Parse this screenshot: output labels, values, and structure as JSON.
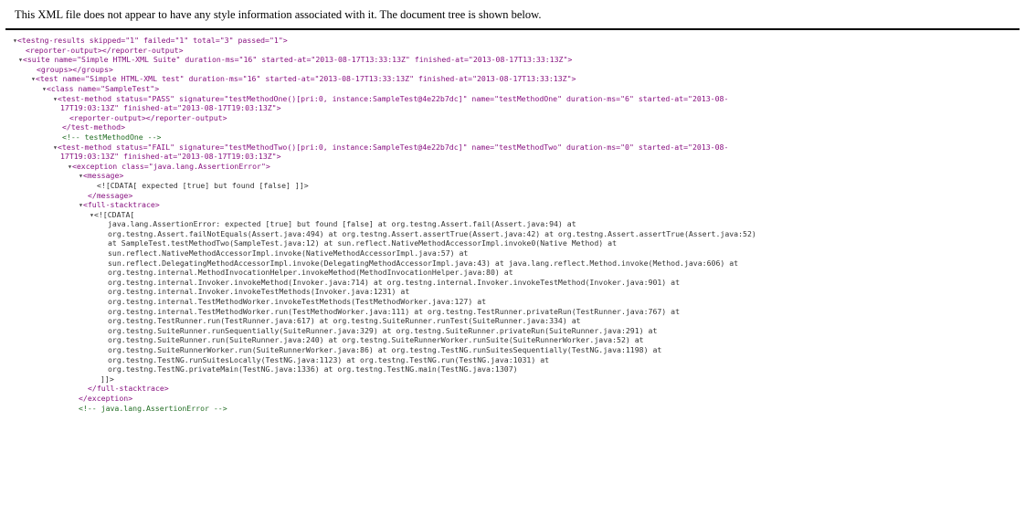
{
  "header": {
    "notice": "This XML file does not appear to have any style information associated with it. The document tree is shown below."
  },
  "colors": {
    "tag": "#881280",
    "attr_name": "#994500",
    "attr_value": "#1a1aa6",
    "comment": "#236e25",
    "text": "#333333"
  },
  "icons": {
    "fold": "expand-collapse-triangle"
  },
  "tree": {
    "results_open": "<testng-results skipped=\"1\" failed=\"1\" total=\"3\" passed=\"1\">",
    "reporter_output": "<reporter-output></reporter-output>",
    "suite_open": "<suite name=\"Simple HTML-XML Suite\" duration-ms=\"16\" started-at=\"2013-08-17T13:33:13Z\" finished-at=\"2013-08-17T13:33:13Z\">",
    "groups": "<groups></groups>",
    "test_open": "<test name=\"Simple HTML-XML test\" duration-ms=\"16\" started-at=\"2013-08-17T13:33:13Z\" finished-at=\"2013-08-17T13:33:13Z\">",
    "class_open": "<class name=\"SampleTest\">",
    "tm1_open_a": "<test-method status=\"PASS\" signature=\"testMethodOne()[pri:0, instance:SampleTest@4e22b7dc]\" name=\"testMethodOne\" duration-ms=\"6\" started-at=\"2013-08-",
    "tm1_open_b": "17T19:03:13Z\" finished-at=\"2013-08-17T19:03:13Z\">",
    "tm1_reporter_output": "<reporter-output></reporter-output>",
    "tm1_close": "</test-method>",
    "tm1_comment": "<!--  testMethodOne  -->",
    "tm2_open_a": "<test-method status=\"FAIL\" signature=\"testMethodTwo()[pri:0, instance:SampleTest@4e22b7dc]\" name=\"testMethodTwo\" duration-ms=\"0\" started-at=\"2013-08-",
    "tm2_open_b": "17T19:03:13Z\" finished-at=\"2013-08-17T19:03:13Z\">",
    "exception_open": "<exception class=\"java.lang.AssertionError\">",
    "message_open": "<message>",
    "message_cdata": "<![CDATA[ expected [true] but found [false] ]]>",
    "message_close": "</message>",
    "stack_open": "<full-stacktrace>",
    "cdata_open": "<![CDATA[",
    "stacktrace": "java.lang.AssertionError: expected [true] but found [false] at org.testng.Assert.fail(Assert.java:94) at\norg.testng.Assert.failNotEquals(Assert.java:494) at org.testng.Assert.assertTrue(Assert.java:42) at org.testng.Assert.assertTrue(Assert.java:52)\nat SampleTest.testMethodTwo(SampleTest.java:12) at sun.reflect.NativeMethodAccessorImpl.invoke0(Native Method) at\nsun.reflect.NativeMethodAccessorImpl.invoke(NativeMethodAccessorImpl.java:57) at\nsun.reflect.DelegatingMethodAccessorImpl.invoke(DelegatingMethodAccessorImpl.java:43) at java.lang.reflect.Method.invoke(Method.java:606) at\norg.testng.internal.MethodInvocationHelper.invokeMethod(MethodInvocationHelper.java:80) at\norg.testng.internal.Invoker.invokeMethod(Invoker.java:714) at org.testng.internal.Invoker.invokeTestMethod(Invoker.java:901) at\norg.testng.internal.Invoker.invokeTestMethods(Invoker.java:1231) at\norg.testng.internal.TestMethodWorker.invokeTestMethods(TestMethodWorker.java:127) at\norg.testng.internal.TestMethodWorker.run(TestMethodWorker.java:111) at org.testng.TestRunner.privateRun(TestRunner.java:767) at\norg.testng.TestRunner.run(TestRunner.java:617) at org.testng.SuiteRunner.runTest(SuiteRunner.java:334) at\norg.testng.SuiteRunner.runSequentially(SuiteRunner.java:329) at org.testng.SuiteRunner.privateRun(SuiteRunner.java:291) at\norg.testng.SuiteRunner.run(SuiteRunner.java:240) at org.testng.SuiteRunnerWorker.runSuite(SuiteRunnerWorker.java:52) at\norg.testng.SuiteRunnerWorker.run(SuiteRunnerWorker.java:86) at org.testng.TestNG.runSuitesSequentially(TestNG.java:1198) at\norg.testng.TestNG.runSuitesLocally(TestNG.java:1123) at org.testng.TestNG.run(TestNG.java:1031) at\norg.testng.TestNG.privateMain(TestNG.java:1336) at org.testng.TestNG.main(TestNG.java:1307)",
    "cdata_close": "]]>",
    "stack_close": "</full-stacktrace>",
    "exception_close": "</exception>",
    "exception_comment": "<!--  java.lang.AssertionError  -->"
  }
}
